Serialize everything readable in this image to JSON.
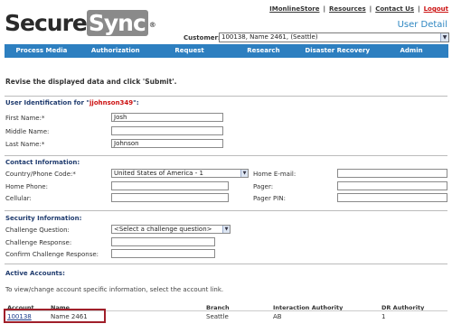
{
  "brand": {
    "secure": "Secure",
    "sync": "Sync",
    "reg": "®"
  },
  "toplinks": [
    "IMonlineStore",
    "Resources",
    "Contact Us",
    "Logout"
  ],
  "page_title": "User Detail",
  "customer": {
    "label": "Customer:",
    "value": "100138, Name 2461, (Seattle)"
  },
  "nav": [
    "Process Media",
    "Authorization",
    "Request",
    "Research",
    "Disaster Recovery",
    "Admin"
  ],
  "instruction": "Revise the displayed data and click 'Submit'.",
  "identification": {
    "title_prefix": "User Identification for \"",
    "username": "jjohnson349",
    "title_suffix": "\":",
    "first_name_label": "First Name:*",
    "first_name": "Josh",
    "middle_name_label": "Middle Name:",
    "middle_name": "",
    "last_name_label": "Last Name:*",
    "last_name": "Johnson"
  },
  "contact": {
    "title": "Contact Information:",
    "country_label": "Country/Phone Code:*",
    "country_value": "United States of America - 1",
    "home_phone_label": "Home Phone:",
    "cellular_label": "Cellular:",
    "home_email_label": "Home E-mail:",
    "pager_label": "Pager:",
    "pager_pin_label": "Pager PIN:"
  },
  "security": {
    "title": "Security Information:",
    "question_label": "Challenge Question:",
    "question_value": "<Select a challenge question>",
    "response_label": "Challenge Response:",
    "confirm_label": "Confirm Challenge Response:"
  },
  "accounts": {
    "title": "Active Accounts:",
    "hint": "To view/change account specific information, select the account link.",
    "headers": [
      "Account",
      "Name",
      "Branch",
      "Interaction Authority",
      "DR Authority"
    ],
    "rows": [
      {
        "account": "100138",
        "name": "Name 2461",
        "branch": "Seattle",
        "interaction": "AB",
        "dr": "1"
      }
    ]
  }
}
